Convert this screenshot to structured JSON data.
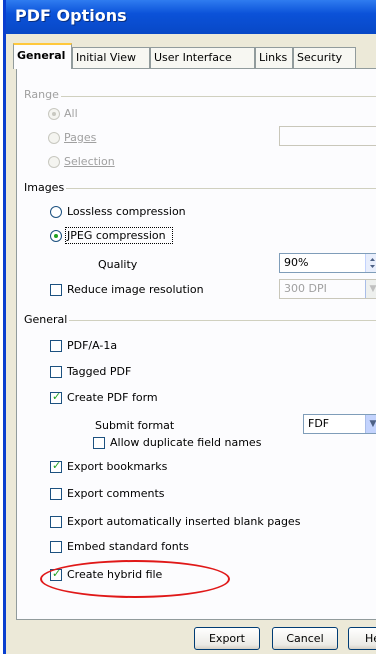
{
  "window": {
    "title": "PDF Options"
  },
  "tabs": [
    "General",
    "Initial View",
    "User Interface",
    "Links",
    "Security"
  ],
  "range": {
    "label": "Range",
    "options": [
      "All",
      "Pages",
      "Selection"
    ],
    "selected": "All"
  },
  "images": {
    "label": "Images",
    "lossless": "Lossless compression",
    "jpeg": "JPEG compression",
    "selected": "jpeg",
    "quality_label": "Quality",
    "quality_value": "90%",
    "reduce_label": "Reduce image resolution",
    "reduce_checked": false,
    "resolution_value": "300 DPI"
  },
  "general": {
    "label": "General",
    "pdfa": {
      "label": "PDF/A-1a",
      "checked": false
    },
    "tagged": {
      "label": "Tagged PDF",
      "checked": false
    },
    "create_form": {
      "label": "Create PDF form",
      "checked": true
    },
    "submit_format_label": "Submit format",
    "submit_format_value": "FDF",
    "allow_duplicate": {
      "label": "Allow duplicate field names",
      "checked": false
    },
    "export_bookmarks": {
      "label": "Export bookmarks",
      "checked": true
    },
    "export_comments": {
      "label": "Export comments",
      "checked": false
    },
    "export_blank": {
      "label": "Export automatically inserted blank pages",
      "checked": false
    },
    "embed_fonts": {
      "label": "Embed standard fonts",
      "checked": false
    },
    "hybrid": {
      "label": "Create hybrid file",
      "checked": true
    }
  },
  "buttons": {
    "export": "Export",
    "cancel": "Cancel",
    "help": "He"
  },
  "colors": {
    "titlebar": "#0b52d9",
    "annotation": "#e01818",
    "check": "#21a121"
  }
}
